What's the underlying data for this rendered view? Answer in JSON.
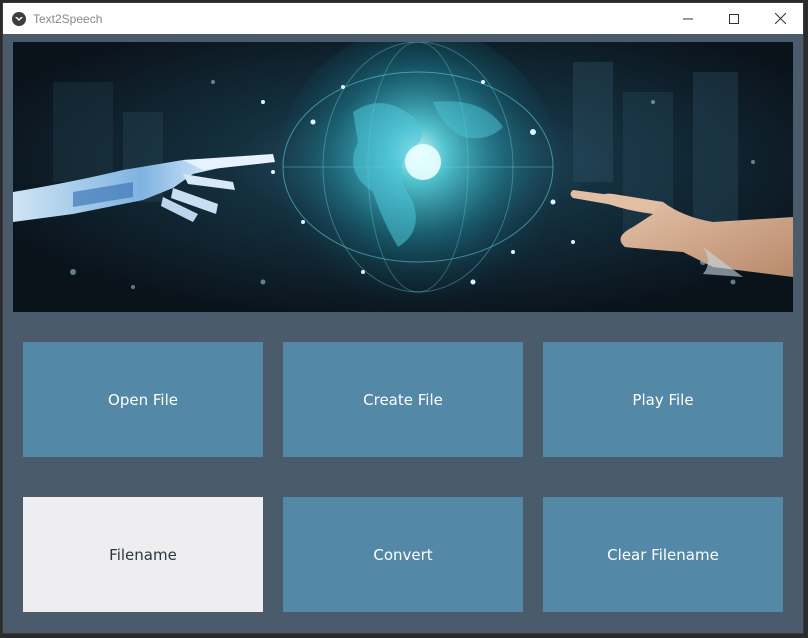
{
  "window": {
    "title": "Text2Speech",
    "icons": [
      "app-icon",
      "minimize-icon",
      "maximize-icon",
      "close-icon"
    ]
  },
  "banner": {
    "description_icon": "robot-hand-and-human-hand-touching-globe-image"
  },
  "buttons": {
    "open_file": "Open File",
    "create_file": "Create File",
    "play_file": "Play File",
    "convert": "Convert",
    "clear_filename": "Clear Filename"
  },
  "filename_field": {
    "value": "Filename"
  },
  "colors": {
    "background": "#4a5c6b",
    "button": "#5389a6",
    "input": "#eeeef0"
  }
}
